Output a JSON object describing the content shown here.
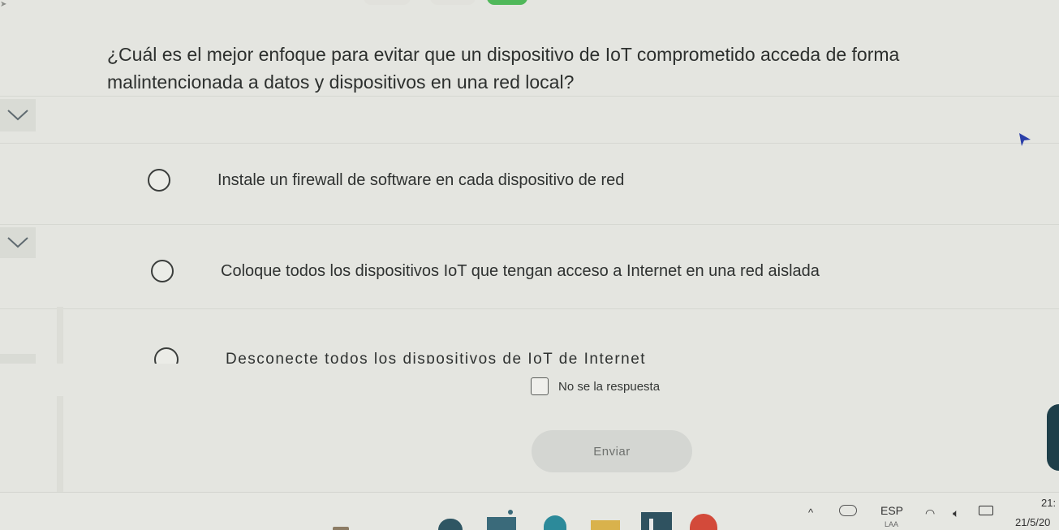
{
  "question": {
    "text": "¿Cuál es el mejor enfoque para evitar que un dispositivo de IoT comprometido acceda de forma\nmalintencionada a datos y dispositivos en una red local?"
  },
  "options": [
    {
      "label": "Instale un firewall de software en cada dispositivo de red"
    },
    {
      "label": "Coloque todos los dispositivos IoT que tengan acceso a Internet en una red aislada"
    },
    {
      "label": "Desconecte todos los dispositivos de IoT de Internet"
    }
  ],
  "dont_know": {
    "label": "No se la respuesta"
  },
  "submit": {
    "label": "Enviar"
  },
  "taskbar": {
    "language": "ESP",
    "language_sub": "LAA",
    "time": "21:",
    "date": "21/5/20"
  },
  "colors": {
    "background": "#e4e5e0",
    "text": "#2f3230",
    "submit_bg": "#d4d6d2",
    "accent_green": "#50b85a"
  }
}
